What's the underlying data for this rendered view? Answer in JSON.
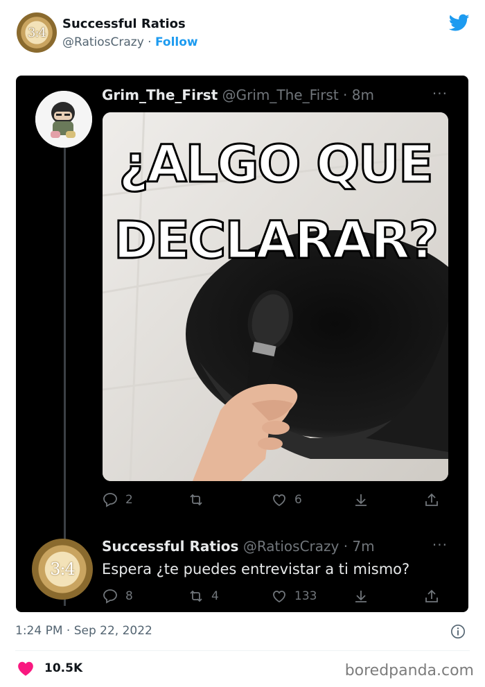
{
  "header": {
    "account_name": "Successful Ratios",
    "handle": "@RatiosCrazy",
    "separator": " · ",
    "follow_label": "Follow",
    "avatar_text": "3:4"
  },
  "tweet1": {
    "display_name": "Grim_The_First",
    "handle": "@Grim_The_First",
    "time": "· 8m",
    "more": "···",
    "meme_line1": "¿ALGO QUE",
    "meme_line2": "DECLARAR?",
    "replies": "2",
    "retweets": "",
    "likes": "6"
  },
  "tweet2": {
    "display_name": "Successful Ratios",
    "handle": "@RatiosCrazy",
    "time": "· 7m",
    "more": "···",
    "avatar_text": "3:4",
    "text": "Espera ¿te puedes entrevistar a ti mismo?",
    "replies": "8",
    "retweets": "4",
    "likes": "133"
  },
  "footer": {
    "timestamp": "1:24 PM · Sep 22, 2022",
    "like_count": "10.5K",
    "brand": "boredpanda.com"
  },
  "colors": {
    "accent": "#1d9bf0",
    "like_pink": "#f91880",
    "dark_bg": "#000000"
  }
}
